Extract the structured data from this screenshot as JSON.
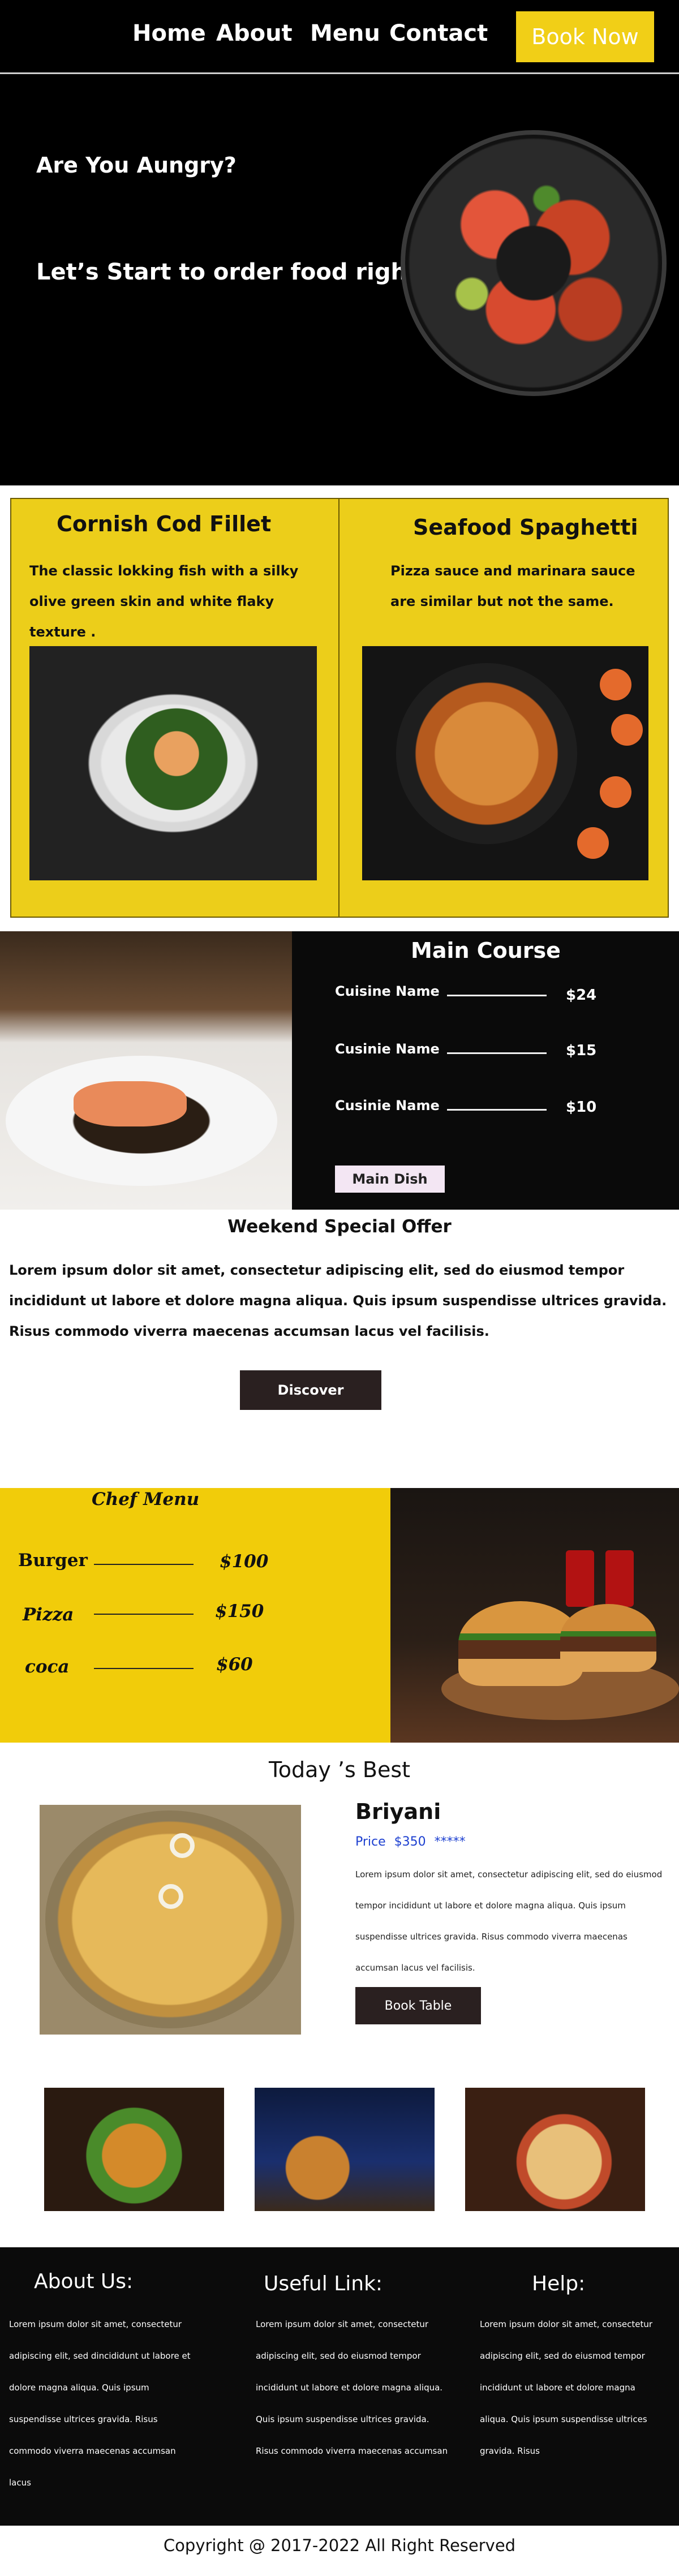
{
  "nav": {
    "home": "Home",
    "about": "About",
    "menu": "Menu",
    "contact": "Contact",
    "book_now": "Book Now"
  },
  "hero": {
    "title": "Are You Aungry?",
    "subtitle": "Let’s Start to order food right now"
  },
  "dishes": [
    {
      "title": "Cornish Cod Fillet",
      "description": "The classic lokking fish with a silky olive green skin and white flaky texture ."
    },
    {
      "title": "Seafood Spaghetti",
      "description": "Pizza sauce and marinara sauce are similar but not the same."
    }
  ],
  "main_course": {
    "title": "Main Course",
    "items": [
      {
        "name": "Cuisine Name",
        "price": "$24"
      },
      {
        "name": "Cusinie Name",
        "price": "$15"
      },
      {
        "name": "Cusinie Name",
        "price": "$10"
      }
    ],
    "button": "Main Dish"
  },
  "weekend_offer": {
    "title": "Weekend Special Offer",
    "text": "Lorem ipsum dolor sit amet, consectetur adipiscing elit, sed do eiusmod tempor incididunt ut labore et dolore magna aliqua. Quis ipsum suspendisse ultrices gravida. Risus commodo viverra maecenas accumsan lacus vel facilisis.",
    "button": "Discover"
  },
  "chef_menu": {
    "title": "Chef Menu",
    "items": [
      {
        "name": "Burger",
        "price": "$100"
      },
      {
        "name": "Pizza",
        "price": "$150"
      },
      {
        "name": "coca",
        "price": "$60"
      }
    ]
  },
  "todays_best": {
    "title": "Today ’s Best",
    "dish": "Briyani",
    "price_label": "Price",
    "price": "$350",
    "stars": "*****",
    "text": "Lorem ipsum dolor sit amet, consectetur adipiscing elit, sed do eiusmod tempor incididunt ut labore et dolore magna aliqua. Quis ipsum suspendisse ultrices gravida. Risus commodo viverra maecenas accumsan lacus vel facilisis.",
    "button": "Book Table"
  },
  "footer": {
    "about_title": "About Us:",
    "about_text": "Lorem ipsum dolor sit amet, consectetur adipiscing elit, sed dincididunt ut labore et dolore magna aliqua. Quis ipsum suspendisse ultrices gravida. Risus commodo viverra maecenas accumsan lacus",
    "links_title": "Useful Link:",
    "links_text": "Lorem ipsum dolor sit amet, consectetur adipiscing elit, sed do eiusmod tempor incididunt ut labore et dolore magna aliqua. Quis ipsum suspendisse ultrices gravida. Risus commodo viverra maecenas accumsan",
    "help_title": "Help:",
    "help_text": "Lorem ipsum dolor sit amet, consectetur adipiscing elit, sed do eiusmod tempor incididunt ut labore et dolore magna aliqua. Quis ipsum suspendisse ultrices gravida. Risus",
    "copyright": "Copyright @ 2017-2022 All Right Reserved"
  },
  "colors": {
    "accent_yellow": "#f1cc0a",
    "dark": "#0a0a0a",
    "button_dark": "#2a2020",
    "price_blue": "#1c3fd0"
  }
}
